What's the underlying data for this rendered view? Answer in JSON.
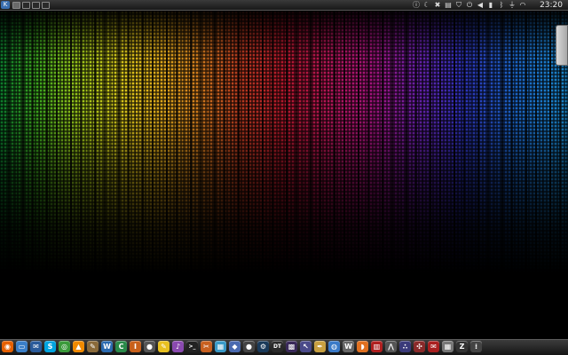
{
  "desktop": {
    "wallpaper": "rainbow-spectrum-dots"
  },
  "top_panel": {
    "kde_button_icon": "kde-icon",
    "pager": [
      "desktop-1",
      "desktop-2",
      "desktop-3",
      "desktop-4"
    ],
    "tray": [
      {
        "name": "info-icon",
        "glyph": "ⓘ"
      },
      {
        "name": "moon-icon",
        "glyph": "☾"
      },
      {
        "name": "tools-icon",
        "glyph": "✖"
      },
      {
        "name": "clipboard-icon",
        "glyph": "▤"
      },
      {
        "name": "shield-icon",
        "glyph": "⛉"
      },
      {
        "name": "power-icon",
        "glyph": "⏻"
      },
      {
        "name": "volume-icon",
        "glyph": "◀"
      },
      {
        "name": "battery-icon",
        "glyph": "▮"
      },
      {
        "name": "bluetooth-icon",
        "glyph": "ᛒ"
      },
      {
        "name": "usb-icon",
        "glyph": "⏚"
      },
      {
        "name": "wifi-icon",
        "glyph": "◠"
      }
    ],
    "clock": "23:20"
  },
  "dock": {
    "icons": [
      {
        "name": "firefox-icon",
        "glyph": "◉",
        "color": "#e66000"
      },
      {
        "name": "files-icon",
        "glyph": "▭",
        "color": "#3a7fc8"
      },
      {
        "name": "thunderbird-icon",
        "glyph": "✉",
        "color": "#2a5a9a"
      },
      {
        "name": "skype-icon",
        "glyph": "S",
        "color": "#00a4e0"
      },
      {
        "name": "chrome-icon",
        "glyph": "◎",
        "color": "#3a9a3a"
      },
      {
        "name": "vlc-icon",
        "glyph": "▲",
        "color": "#f08a00"
      },
      {
        "name": "gimp-icon",
        "glyph": "✎",
        "color": "#8a6a3a"
      },
      {
        "name": "writer-icon",
        "glyph": "W",
        "color": "#2a6ab0"
      },
      {
        "name": "calc-icon",
        "glyph": "C",
        "color": "#2a8a4a"
      },
      {
        "name": "impress-icon",
        "glyph": "I",
        "color": "#c8601a"
      },
      {
        "name": "inkscape-icon",
        "glyph": "●",
        "color": "#555555"
      },
      {
        "name": "notes-icon",
        "glyph": "✎",
        "color": "#e8c020"
      },
      {
        "name": "music-icon",
        "glyph": "♪",
        "color": "#8a4ab0"
      },
      {
        "name": "terminal-icon",
        "glyph": ">_",
        "color": "#222222"
      },
      {
        "name": "tools-app-icon",
        "glyph": "✂",
        "color": "#c86020"
      },
      {
        "name": "photo-icon",
        "glyph": "▦",
        "color": "#3a9ac8"
      },
      {
        "name": "game-icon",
        "glyph": "◆",
        "color": "#4a6ab0"
      },
      {
        "name": "camera-icon",
        "glyph": "●",
        "color": "#444444"
      },
      {
        "name": "steam-icon",
        "glyph": "⚙",
        "color": "#1a3a5a"
      },
      {
        "name": "darktable-icon",
        "glyph": "DT",
        "color": "#2a2a2a"
      },
      {
        "name": "palette-icon",
        "glyph": "▩",
        "color": "#3a2a5a"
      },
      {
        "name": "cursor-icon",
        "glyph": "↖",
        "color": "#4a4a8a"
      },
      {
        "name": "pen-icon",
        "glyph": "✒",
        "color": "#c8a040"
      },
      {
        "name": "globe-icon",
        "glyph": "◍",
        "color": "#3a7ac8"
      },
      {
        "name": "wordpress-icon",
        "glyph": "W",
        "color": "#666666"
      },
      {
        "name": "fox-icon",
        "glyph": "◗",
        "color": "#e07020"
      },
      {
        "name": "media-icon",
        "glyph": "▥",
        "color": "#b02020"
      },
      {
        "name": "triangle-app-icon",
        "glyph": "⋀",
        "color": "#555555"
      },
      {
        "name": "steam-dots-icon",
        "glyph": "∴",
        "color": "#3a3a7a"
      },
      {
        "name": "config-icon",
        "glyph": "✣",
        "color": "#8a2a2a"
      },
      {
        "name": "mail-app-icon",
        "glyph": "✉",
        "color": "#aa2020"
      },
      {
        "name": "calculator-icon",
        "glyph": "▦",
        "color": "#777777"
      },
      {
        "name": "zim-icon",
        "glyph": "Z",
        "color": "#333333"
      },
      {
        "name": "grid-app-icon",
        "glyph": "⁞",
        "color": "#444444"
      }
    ]
  }
}
